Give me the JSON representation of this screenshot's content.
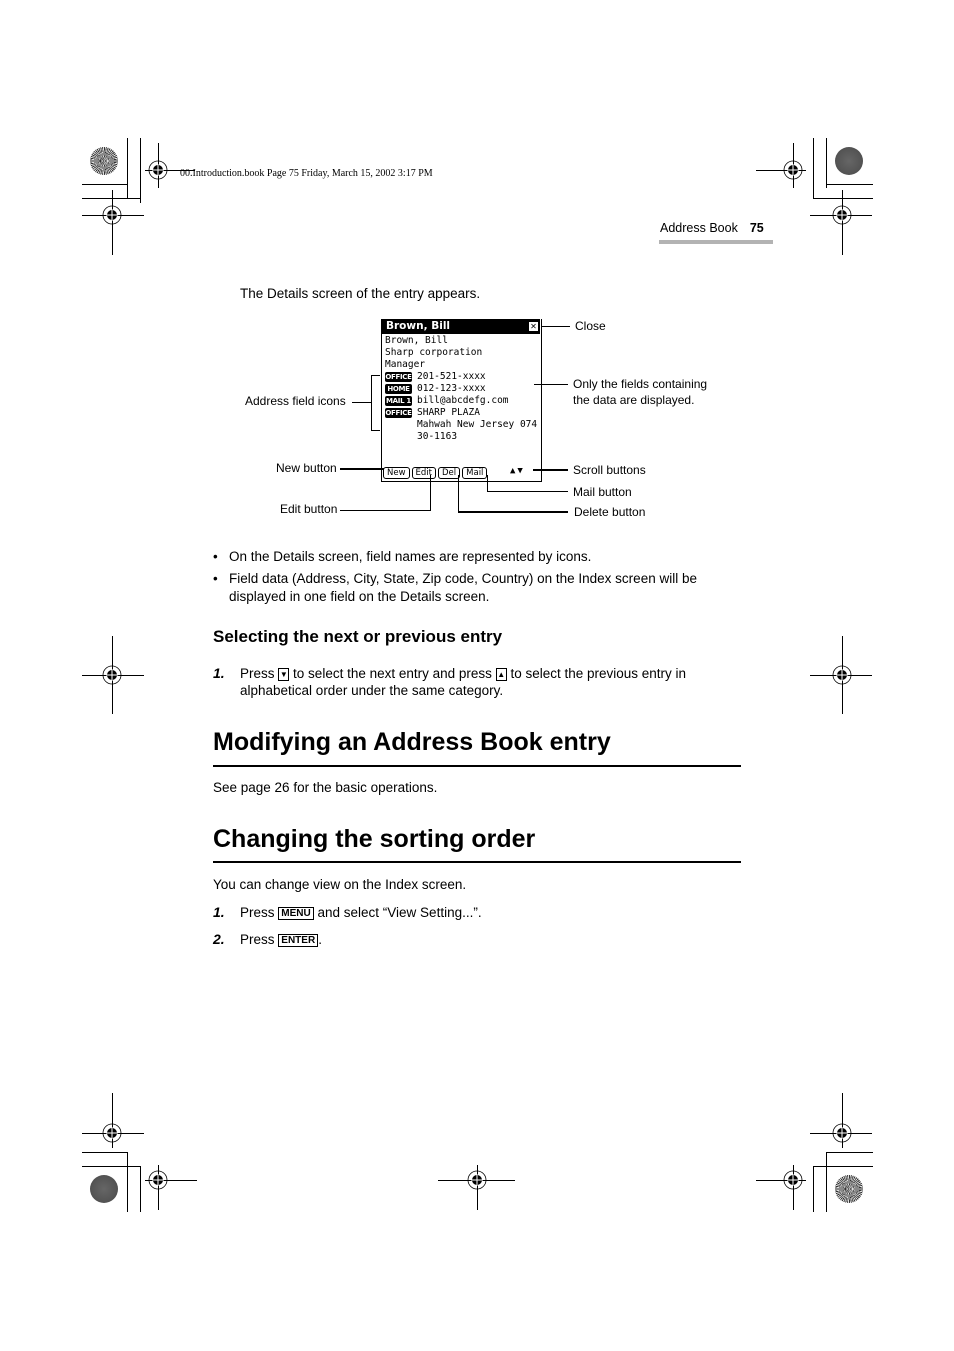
{
  "slug": "00.Introduction.book  Page 75  Friday, March 15, 2002  3:17 PM",
  "running_head": {
    "section": "Address Book",
    "page_number": "75"
  },
  "intro": "The Details screen of the entry appears.",
  "screen": {
    "title": "Brown, Bill",
    "close_icon": "close-icon",
    "lines": [
      {
        "icon": "",
        "text": "Brown, Bill"
      },
      {
        "icon": "",
        "text": "Sharp corporation"
      },
      {
        "icon": "",
        "text": "Manager"
      },
      {
        "icon": "OFFICE",
        "text": "201-521-xxxx"
      },
      {
        "icon": "HOME",
        "text": "012-123-xxxx"
      },
      {
        "icon": "MAIL 1",
        "text": "bill@abcdefg.com"
      },
      {
        "icon": "OFFICE",
        "text": "SHARP PLAZA"
      },
      {
        "icon": "",
        "text": "Mahwah New Jersey 074"
      },
      {
        "icon": "",
        "text": "30-1163"
      }
    ],
    "buttons": [
      "New",
      "Edit",
      "Del",
      "Mail"
    ],
    "scroll": "▲▼"
  },
  "callouts": {
    "close": "Close",
    "fields_line1": "Only the fields containing",
    "fields_line2": "the data are displayed.",
    "address_icons": "Address field icons",
    "new_button": "New button",
    "edit_button": "Edit button",
    "scroll_buttons": "Scroll buttons",
    "mail_button": "Mail button",
    "delete_button": "Delete button"
  },
  "bullets": [
    "On the Details screen, field names are represented by icons.",
    "Field data (Address, City, State, Zip code, Country) on the Index screen will be displayed in one field on the Details screen."
  ],
  "section_select": {
    "heading": "Selecting the next or previous entry",
    "step1": {
      "number": "1.",
      "a": "Press",
      "key_down": "▼",
      "b": "to select the next entry and press",
      "key_up": "▲",
      "c": "to select the previous entry in alphabetical order under the same category."
    }
  },
  "section_modify": {
    "heading": "Modifying an Address Book entry",
    "text": "See page 26 for the basic operations."
  },
  "section_sort": {
    "heading": "Changing the sorting order",
    "text": "You can change view on the Index screen.",
    "step1": {
      "number": "1.",
      "a": "Press",
      "key": "MENU",
      "b": "and select “View Setting...”."
    },
    "step2": {
      "number": "2.",
      "a": "Press",
      "key": "ENTER",
      "b": "."
    }
  }
}
